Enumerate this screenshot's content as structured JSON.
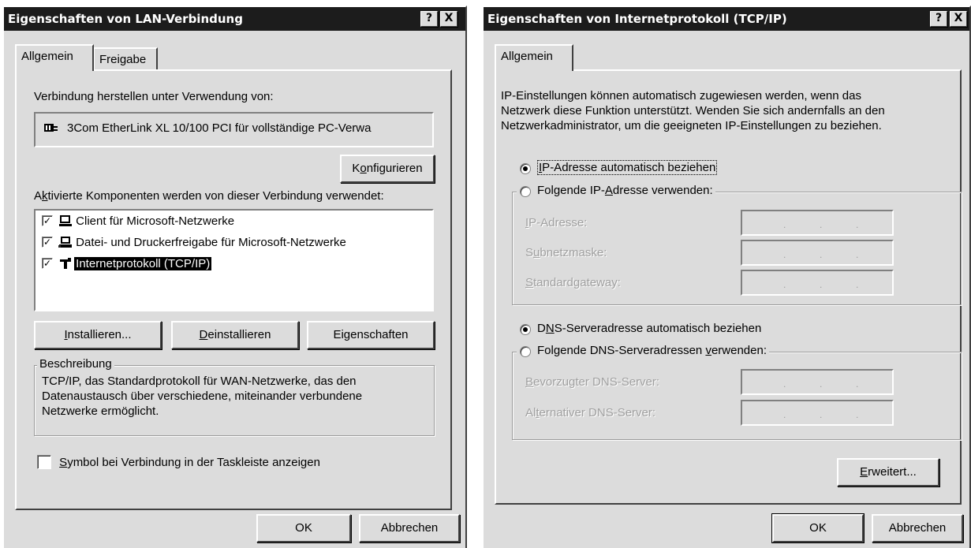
{
  "left_dialog": {
    "title": "Eigenschaften von LAN-Verbindung",
    "help_btn": "?",
    "close_btn": "X",
    "tabs": [
      {
        "label": "Allgemein"
      },
      {
        "label": "Freigabe"
      }
    ],
    "connect_using_label": "Verbindung herstellen unter Verwendung von:",
    "adapter_name": "3Com EtherLink XL 10/100 PCI für vollständige PC-Verwa",
    "configure_btn": {
      "pre": "K",
      "key": "o",
      "post": "nfigurieren"
    },
    "components_label": {
      "pre": "A",
      "key": "k",
      "post": "tivierte Komponenten werden von dieser Verbindung verwendet:"
    },
    "components": [
      {
        "label": "Client für Microsoft-Netzwerke",
        "checked": true,
        "icon": "network-client-icon",
        "selected": false
      },
      {
        "label": "Datei- und Druckerfreigabe für Microsoft-Netzwerke",
        "checked": true,
        "icon": "file-printer-sharing-icon",
        "selected": false
      },
      {
        "label": "Internetprotokoll (TCP/IP)",
        "checked": true,
        "icon": "protocol-icon",
        "selected": true
      }
    ],
    "install_btn": {
      "key": "I",
      "post": "nstallieren..."
    },
    "uninstall_btn": {
      "key": "D",
      "post": "einstallieren"
    },
    "properties_btn": {
      "pre": "Ei",
      "key": "g",
      "post": "enschaften"
    },
    "description_legend": "Beschreibung",
    "description_text": "TCP/IP, das Standardprotokoll für WAN-Netzwerke, das den Datenaustausch über verschiedene, miteinander verbundene Netzwerke ermöglicht.",
    "taskbar_checkbox": {
      "key": "S",
      "post": "ymbol bei Verbindung in der Taskleiste anzeigen",
      "checked": false
    },
    "ok_btn": "OK",
    "cancel_btn": "Abbrechen"
  },
  "right_dialog": {
    "title": "Eigenschaften von Internetprotokoll (TCP/IP)",
    "help_btn": "?",
    "close_btn": "X",
    "tabs": [
      {
        "label": "Allgemein"
      }
    ],
    "intro_text": "IP-Einstellungen können automatisch zugewiesen werden, wenn das Netzwerk diese Funktion unterstützt. Wenden Sie sich andernfalls an den Netzwerkadministrator, um die geeigneten IP-Einstellungen zu beziehen.",
    "ip_auto_radio": {
      "pre": "I",
      "key": "P",
      "post": "-Adresse automatisch beziehen",
      "checked": true
    },
    "ip_manual_radio": {
      "pre": "Folgende IP-",
      "key": "A",
      "post": "dresse verwenden:",
      "checked": false
    },
    "ip_address": {
      "key": "I",
      "post": "P-Adresse:",
      "value": ". . ."
    },
    "subnet_mask": {
      "pre": "S",
      "key": "u",
      "post": "bnetzmaske:",
      "value": ". . ."
    },
    "gateway": {
      "key": "S",
      "post": "tandardgateway:",
      "value": ". . ."
    },
    "dns_auto_radio": {
      "pre": "D",
      "key": "N",
      "post": "S-Serveradresse automatisch beziehen",
      "checked": true
    },
    "dns_manual_radio": {
      "pre": "Folgende DNS-Serveradressen ",
      "key": "v",
      "post": "erwenden:",
      "checked": false
    },
    "preferred_dns": {
      "key": "B",
      "post": "evorzugter DNS-Server:",
      "value": ". . ."
    },
    "alternate_dns": {
      "pre": "Al",
      "key": "t",
      "post": "ernativer DNS-Server:",
      "value": ". . ."
    },
    "advanced_btn": {
      "key": "E",
      "post": "rweitert..."
    },
    "ok_btn": "OK",
    "cancel_btn": "Abbrechen"
  }
}
